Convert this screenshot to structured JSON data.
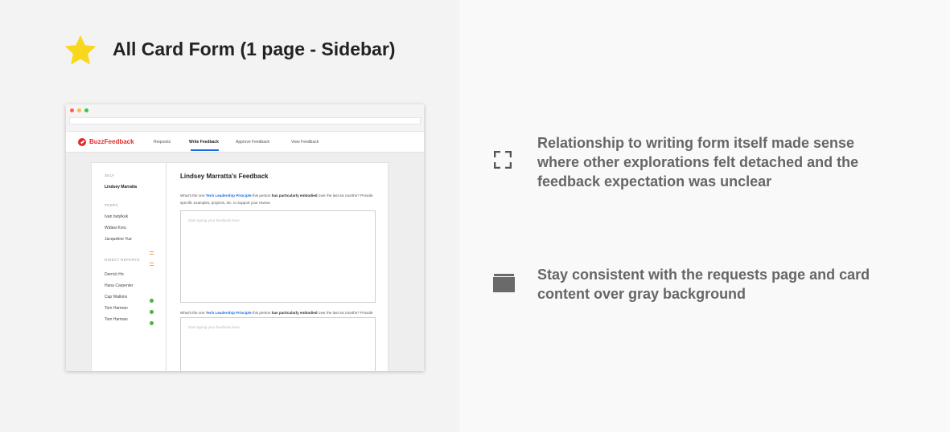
{
  "title": "All Card Form (1 page - Sidebar)",
  "colors": {
    "star": "#f9d71c",
    "brand": "#e32d2d",
    "link": "#1a6fdc",
    "check": "#49b43c",
    "flag": "#f39a3c"
  },
  "icons": {
    "title": "star-icon",
    "note1": "focus-frame-icon",
    "note2": "card-stack-icon"
  },
  "app": {
    "brand": "BuzzFeedback",
    "nav": {
      "requests": "Requests",
      "write": "Write Feedback",
      "approve": "Approve Feedback",
      "view": "View Feedback"
    },
    "active_tab": "Write Feedback"
  },
  "sidebar": {
    "self_header": "SELF",
    "self_name": "Lindsey Marratta",
    "peers_header": "PEERS",
    "peers": [
      "Ivan butylkuk",
      "Widasi Koru",
      "Jacqueline Yue"
    ],
    "reports_header": "DIRECT REPORTS",
    "reports": [
      "Derrick Ho",
      "Hana Carpenter",
      "Cap Watkins",
      "Tom Harman",
      "Tom Harman"
    ]
  },
  "form": {
    "title": "Lindsey Marratta's Feedback",
    "q_prefix": "What's the one",
    "q_link": "Tech Leadership Principle",
    "q_mid": "this person",
    "q_bold": "has particularly embodied",
    "q_end": "over the last six months? Provide specific examples, projects, etc. to support your review.",
    "placeholder": "Start typing your feedback here"
  },
  "notes": [
    "Relationship to writing form itself made sense where other explorations felt detached and the feedback expectation was unclear",
    "Stay consistent with the requests page and card content over gray background"
  ]
}
